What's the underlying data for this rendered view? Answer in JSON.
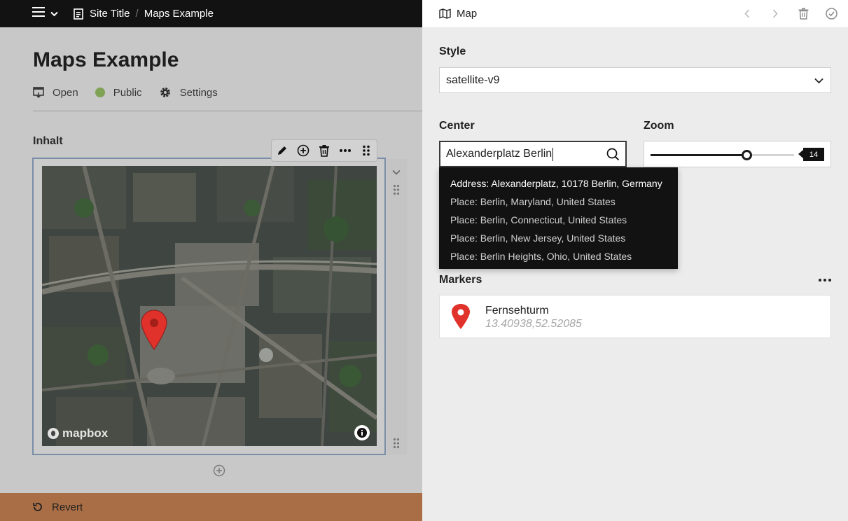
{
  "topbar": {
    "site_title": "Site Title",
    "separator": "/",
    "page_name": "Maps Example"
  },
  "editor": {
    "page_title": "Maps Example",
    "meta": {
      "open_label": "Open",
      "public_label": "Public",
      "settings_label": "Settings"
    },
    "section_label": "Inhalt",
    "map": {
      "attribution_logo": "mapbox"
    },
    "revert_label": "Revert"
  },
  "panel": {
    "title": "Map",
    "style": {
      "label": "Style",
      "value": "satellite-v9"
    },
    "center": {
      "label": "Center",
      "value": "Alexanderplatz Berlin"
    },
    "zoom": {
      "label": "Zoom",
      "value": "14",
      "fraction": 0.67
    },
    "suggestions": [
      "Address: Alexanderplatz, 10178 Berlin, Germany",
      "Place: Berlin, Maryland, United States",
      "Place: Berlin, Connecticut, United States",
      "Place: Berlin, New Jersey, United States",
      "Place: Berlin Heights, Ohio, United States"
    ],
    "markers": {
      "label": "Markers",
      "items": [
        {
          "name": "Fernsehturm",
          "coords": "13.40938,52.52085"
        }
      ]
    }
  },
  "colors": {
    "topbar_bg": "#121212",
    "revert_bg": "#a96e45",
    "public_dot": "#7fa254",
    "marker_red": "#e0312b"
  }
}
